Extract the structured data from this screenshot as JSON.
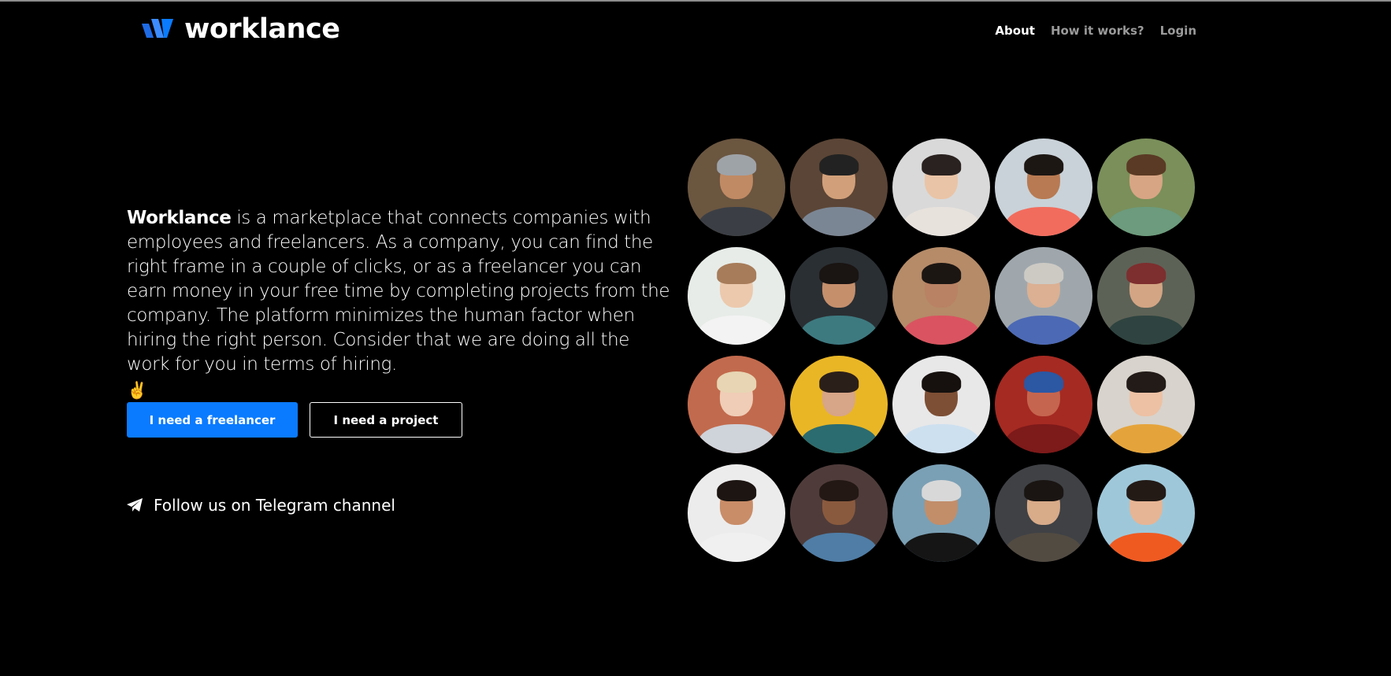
{
  "header": {
    "logo_text": "worklance",
    "nav": [
      {
        "label": "About",
        "active": true
      },
      {
        "label": "How it works?",
        "active": false
      },
      {
        "label": "Login",
        "active": false
      }
    ]
  },
  "hero": {
    "brand": "Worklance",
    "text": " is a marketplace that connects companies with employees and freelancers. As a company, you can find the right frame in a couple of clicks, or as a freelancer you can earn money in your free time by completing projects from the company. The platform minimizes the human factor when hiring the right person. Consider that we are doing all the work for you in terms of hiring.",
    "emoji": "✌"
  },
  "buttons": {
    "primary_label": "I need a freelancer",
    "secondary_label": "I need a project"
  },
  "telegram": {
    "label": "Follow us on Telegram channel",
    "icon": "telegram-icon"
  },
  "colors": {
    "background": "#000000",
    "accent": "#0a7bff",
    "nav_active": "#ffffff",
    "nav_inactive": "#9a9a9a"
  },
  "avatars": [
    {
      "bg": "#6b5640",
      "skin": "#c08a64",
      "hair": "#9ea3a8",
      "shirt": "#3b3f45"
    },
    {
      "bg": "#5b4536",
      "skin": "#d1a07a",
      "hair": "#222222",
      "shirt": "#7b8694"
    },
    {
      "bg": "#d9d9d9",
      "skin": "#eac4a6",
      "hair": "#2a2220",
      "shirt": "#e7e2dc"
    },
    {
      "bg": "#c9d2d8",
      "skin": "#b87a52",
      "hair": "#1d1714",
      "shirt": "#f26c5d"
    },
    {
      "bg": "#7a8f5a",
      "skin": "#d7a584",
      "hair": "#5a3a24",
      "shirt": "#6c9b7d"
    },
    {
      "bg": "#e7ece8",
      "skin": "#ecc9ad",
      "hair": "#a77c5a",
      "shirt": "#f3f3f3"
    },
    {
      "bg": "#2a2f33",
      "skin": "#c58f6c",
      "hair": "#1a1412",
      "shirt": "#3d7a80"
    },
    {
      "bg": "#b58b68",
      "skin": "#b98264",
      "hair": "#1c1613",
      "shirt": "#d95460"
    },
    {
      "bg": "#9fa7ad",
      "skin": "#dbb093",
      "hair": "#cdcac4",
      "shirt": "#4c69b5"
    },
    {
      "bg": "#5d6256",
      "skin": "#d3a584",
      "hair": "#7d2e2e",
      "shirt": "#2f4440"
    },
    {
      "bg": "#c26a4d",
      "skin": "#efcdb7",
      "hair": "#e7d5b3",
      "shirt": "#cfd3da"
    },
    {
      "bg": "#e9b626",
      "skin": "#d7a587",
      "hair": "#2b1f1a",
      "shirt": "#2b6c70"
    },
    {
      "bg": "#e8e8e8",
      "skin": "#7d4f35",
      "hair": "#16110f",
      "shirt": "#cde0f0"
    },
    {
      "bg": "#a52a22",
      "skin": "#c5654f",
      "hair": "#2b57a3",
      "shirt": "#7d1a1a"
    },
    {
      "bg": "#d8d3cc",
      "skin": "#ecc1a4",
      "hair": "#221b18",
      "shirt": "#e5a43b"
    },
    {
      "bg": "#ececec",
      "skin": "#c98d68",
      "hair": "#1c1512",
      "shirt": "#f0f0f0"
    },
    {
      "bg": "#4f3c3a",
      "skin": "#8a5a3e",
      "hair": "#231814",
      "shirt": "#4f7da6"
    },
    {
      "bg": "#7aa0b5",
      "skin": "#c28e6a",
      "hair": "#d8d8d8",
      "shirt": "#151515"
    },
    {
      "bg": "#3f4145",
      "skin": "#d8ab89",
      "hair": "#1a1513",
      "shirt": "#524b42"
    },
    {
      "bg": "#9ec8da",
      "skin": "#e6b595",
      "hair": "#231a16",
      "shirt": "#ef5a21"
    }
  ]
}
